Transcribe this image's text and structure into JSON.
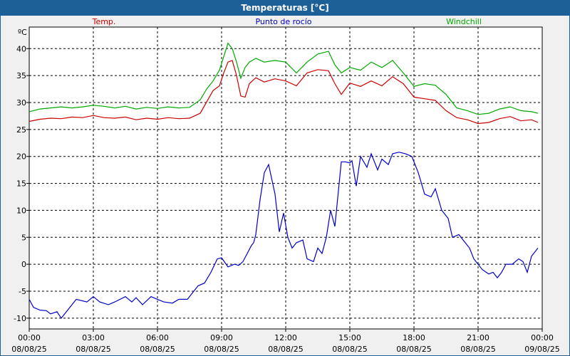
{
  "window": {
    "title": "Temperaturas [°C]"
  },
  "chart_data": {
    "type": "line",
    "title": "Temperaturas [°C]",
    "unit_label": "ºC",
    "ylim": [
      -12,
      44
    ],
    "yticks": [
      -10,
      -5,
      0,
      5,
      10,
      15,
      20,
      25,
      30,
      35,
      40
    ],
    "xlim": [
      0,
      24
    ],
    "xticks": [
      {
        "h": 0,
        "time": "00:00",
        "date": "08/08/25"
      },
      {
        "h": 3,
        "time": "03:00",
        "date": "08/08/25"
      },
      {
        "h": 6,
        "time": "06:00",
        "date": "08/08/25"
      },
      {
        "h": 9,
        "time": "09:00",
        "date": "08/08/25"
      },
      {
        "h": 12,
        "time": "12:00",
        "date": "08/08/25"
      },
      {
        "h": 15,
        "time": "15:00",
        "date": "08/08/25"
      },
      {
        "h": 18,
        "time": "18:00",
        "date": "08/08/25"
      },
      {
        "h": 21,
        "time": "21:00",
        "date": "08/08/25"
      },
      {
        "h": 24,
        "time": "00:00",
        "date": "09/08/25"
      }
    ],
    "grid": true,
    "series": [
      {
        "name": "Temp.",
        "color": "#cc0000",
        "legend_pos": "left",
        "x": [
          0,
          0.5,
          1,
          1.5,
          2,
          2.5,
          3,
          3.5,
          4,
          4.5,
          5,
          5.5,
          6,
          6.5,
          7,
          7.5,
          8,
          8.3,
          8.6,
          8.9,
          9.1,
          9.3,
          9.5,
          9.7,
          9.9,
          10.1,
          10.3,
          10.6,
          11,
          11.5,
          12,
          12.5,
          13,
          13.5,
          14,
          14.3,
          14.6,
          15,
          15.5,
          16,
          16.5,
          17,
          17.5,
          18,
          18.5,
          19,
          19.5,
          20,
          20.5,
          21,
          21.5,
          22,
          22.5,
          23,
          23.5,
          23.8
        ],
        "values": [
          26.5,
          26.9,
          27.1,
          27.0,
          27.3,
          27.2,
          27.6,
          27.2,
          27.1,
          27.3,
          26.8,
          27.1,
          26.9,
          27.2,
          27.0,
          27.1,
          28.0,
          30.1,
          32.2,
          33.1,
          35.5,
          37.5,
          37.8,
          35.0,
          31.2,
          31.0,
          33.5,
          34.6,
          33.8,
          34.4,
          34.0,
          33.1,
          35.5,
          36.1,
          35.9,
          33.5,
          31.5,
          33.6,
          33.0,
          34.0,
          33.1,
          34.8,
          33.5,
          31.0,
          30.7,
          30.4,
          28.5,
          27.2,
          26.8,
          26.1,
          26.3,
          27.0,
          27.4,
          26.6,
          26.8,
          26.3
        ]
      },
      {
        "name": "Punto de rocío",
        "color": "#0000cc",
        "legend_pos": "center",
        "x": [
          0,
          0.2,
          0.5,
          0.8,
          1.0,
          1.3,
          1.5,
          1.8,
          2.2,
          2.7,
          3.0,
          3.3,
          3.7,
          4.0,
          4.5,
          4.8,
          5.0,
          5.3,
          5.7,
          6.0,
          6.3,
          6.7,
          7.0,
          7.4,
          7.7,
          7.9,
          8.2,
          8.5,
          8.8,
          9.0,
          9.3,
          9.6,
          9.8,
          10.0,
          10.2,
          10.4,
          10.5,
          10.6,
          10.8,
          11.0,
          11.2,
          11.5,
          11.7,
          11.9,
          12.1,
          12.3,
          12.5,
          12.8,
          13.0,
          13.3,
          13.5,
          13.7,
          13.9,
          14.1,
          14.3,
          14.6,
          14.8,
          15.0,
          15.1,
          15.3,
          15.5,
          15.8,
          16.0,
          16.3,
          16.5,
          16.8,
          17.0,
          17.3,
          17.6,
          17.9,
          18.2,
          18.5,
          18.8,
          19.0,
          19.3,
          19.6,
          19.8,
          20.1,
          20.4,
          20.6,
          20.8,
          21.0,
          21.2,
          21.5,
          21.7,
          21.9,
          22.1,
          22.3,
          22.6,
          22.9,
          23.1,
          23.3,
          23.5,
          23.7,
          23.8
        ],
        "values": [
          -6.5,
          -8.0,
          -8.5,
          -8.6,
          -9.2,
          -8.8,
          -10.0,
          -8.5,
          -6.5,
          -7.0,
          -6.0,
          -7.0,
          -7.5,
          -7.0,
          -6.0,
          -7.0,
          -6.2,
          -7.5,
          -6.0,
          -6.5,
          -7.0,
          -7.2,
          -6.5,
          -6.5,
          -5.0,
          -4.0,
          -3.5,
          -1.5,
          1.0,
          1.2,
          -0.5,
          0.0,
          -0.2,
          0.5,
          2.0,
          3.5,
          4.0,
          5.5,
          12.0,
          17.0,
          18.5,
          13.0,
          6.0,
          9.5,
          5.0,
          3.0,
          4.0,
          4.5,
          1.0,
          0.5,
          3.0,
          2.0,
          5.0,
          10.0,
          7.0,
          19.0,
          19.0,
          18.8,
          19.2,
          14.5,
          20.0,
          18.0,
          20.5,
          17.5,
          19.5,
          18.5,
          20.5,
          20.8,
          20.5,
          20.0,
          17.0,
          13.0,
          12.5,
          14.0,
          10.0,
          8.5,
          5.0,
          5.5,
          4.0,
          3.0,
          1.0,
          0.0,
          -1.0,
          -1.8,
          -1.5,
          -2.5,
          -1.5,
          0.0,
          0.0,
          1.0,
          0.5,
          -1.5,
          1.5,
          2.5,
          3.0
        ]
      },
      {
        "name": "Windchill",
        "color": "#00aa00",
        "legend_pos": "right",
        "x": [
          0,
          0.5,
          1,
          1.5,
          2,
          2.5,
          3,
          3.5,
          4,
          4.5,
          5,
          5.5,
          6,
          6.5,
          7,
          7.5,
          8,
          8.3,
          8.6,
          8.9,
          9.1,
          9.3,
          9.5,
          9.7,
          9.9,
          10.1,
          10.3,
          10.6,
          11,
          11.5,
          12,
          12.5,
          13,
          13.5,
          14,
          14.3,
          14.6,
          15,
          15.5,
          16,
          16.5,
          17,
          17.5,
          18,
          18.5,
          19,
          19.5,
          20,
          20.5,
          21,
          21.5,
          22,
          22.5,
          23,
          23.5,
          23.8
        ],
        "values": [
          28.3,
          28.8,
          29.0,
          29.2,
          29.0,
          29.2,
          29.5,
          29.3,
          29.0,
          29.3,
          28.8,
          29.1,
          28.9,
          29.2,
          29.0,
          29.1,
          30.5,
          32.5,
          34.0,
          36.0,
          38.5,
          41.0,
          40.0,
          37.5,
          34.5,
          36.5,
          37.5,
          38.2,
          37.5,
          37.8,
          37.5,
          35.5,
          37.5,
          39.0,
          39.5,
          37.0,
          35.5,
          36.5,
          36.0,
          37.5,
          36.5,
          37.8,
          35.5,
          33.0,
          33.5,
          33.2,
          31.5,
          29.0,
          28.5,
          27.8,
          28.0,
          28.8,
          29.2,
          28.5,
          28.3,
          28.0
        ]
      }
    ]
  }
}
